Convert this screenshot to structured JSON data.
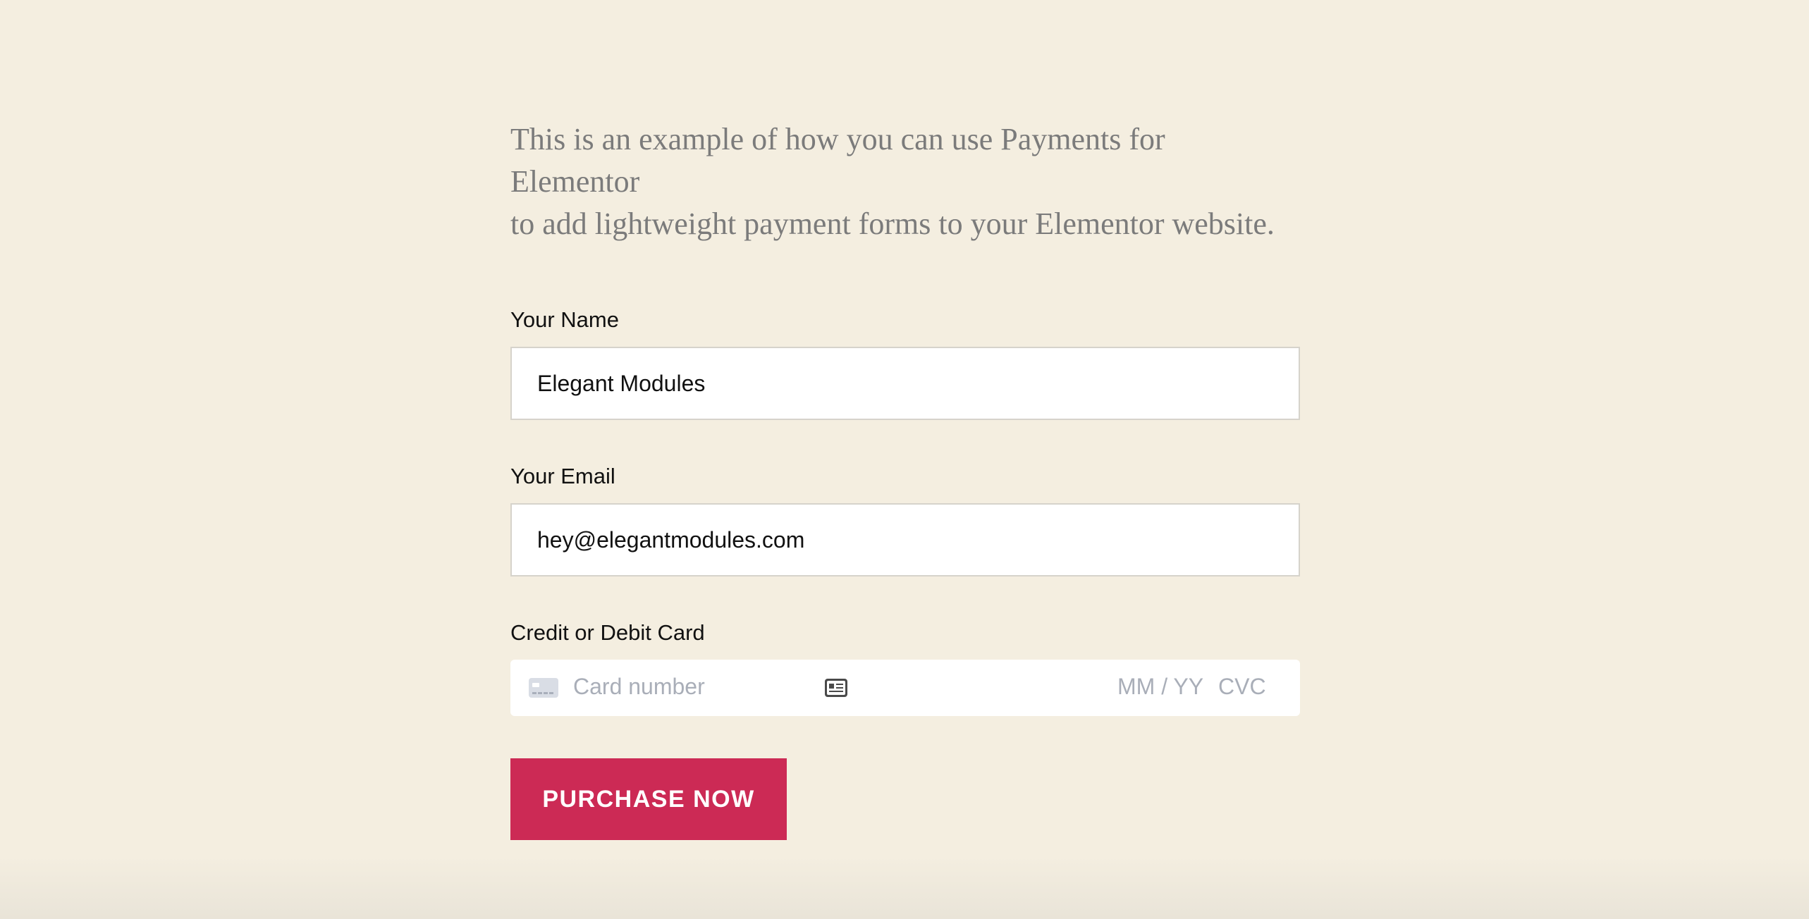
{
  "intro": {
    "line1": "This is an example of how you can use Payments for Elementor",
    "line2": "to add lightweight payment forms to your Elementor website."
  },
  "form": {
    "name_label": "Your Name",
    "name_value": "Elegant Modules",
    "email_label": "Your Email",
    "email_value": "hey@elegantmodules.com",
    "card_label": "Credit or Debit Card",
    "card": {
      "number_placeholder": "Card number",
      "expiry_placeholder": "MM / YY",
      "cvc_placeholder": "CVC",
      "card_icon": "credit-card-icon",
      "autofill_icon": "contact-card-icon"
    },
    "submit_label": "PURCHASE NOW"
  },
  "colors": {
    "background": "#f4eee0",
    "button": "#cc2a55",
    "intro_text": "#7b7b7b",
    "placeholder": "#a9aeb8"
  }
}
